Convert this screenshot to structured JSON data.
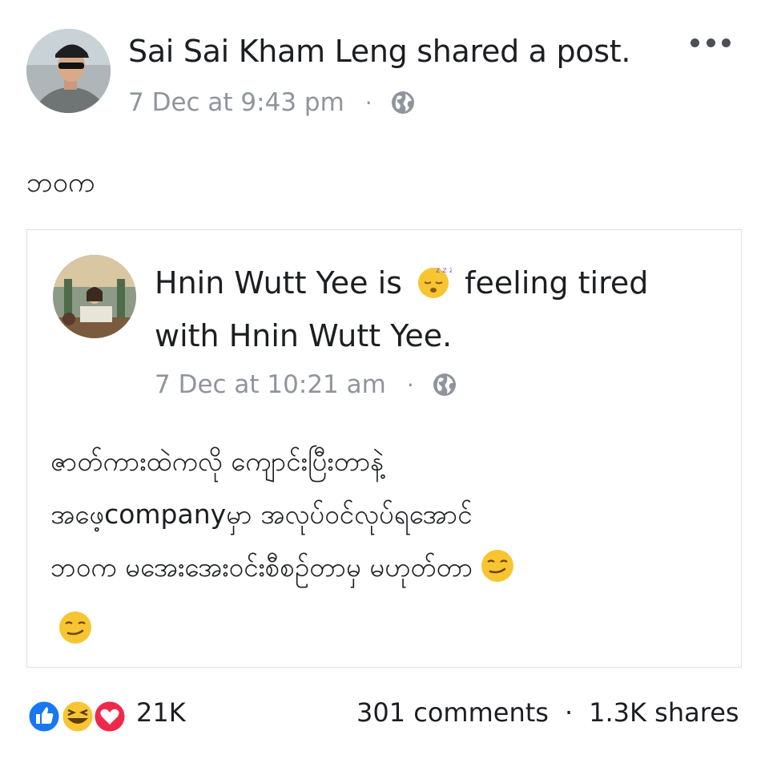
{
  "outer_post": {
    "author": "Sai Sai Kham Leng",
    "action": "shared a post.",
    "time": "7 Dec at 9:43 pm",
    "privacy_icon": "globe-icon",
    "text": "ဘဝက"
  },
  "shared_post": {
    "author": "Hnin Wutt Yee",
    "is_label": "is",
    "feeling_emoji": "sleepy-face-icon",
    "feeling": "feeling tired",
    "with_text": "with Hnin Wutt Yee.",
    "time": "7 Dec at 10:21 am",
    "privacy_icon": "globe-icon",
    "text_lines": [
      "ဇာတ်ကားထဲကလို ကျောင်းပြီးတာနဲ့",
      "အဖေ့companyမှာ အလုပ်ဝင်လုပ်ရအောင်",
      "ဘဝက မအေးအေးဝင်းစီစဉ်တာမှ မဟုတ်တာ"
    ],
    "text_emoji": "smirking-face-icon"
  },
  "footer": {
    "reactions": [
      "like-icon",
      "laughing-face-icon",
      "love-icon"
    ],
    "reactions_count": "21K",
    "comments": "301 comments",
    "separator": "·",
    "shares": "1.3K shares"
  },
  "colors": {
    "text": "#1c1e21",
    "meta": "#90949c",
    "border": "#dddfe2",
    "like_blue": "#1877f2",
    "love_red": "#f0284a",
    "emoji_yellow": "#f7c531"
  }
}
